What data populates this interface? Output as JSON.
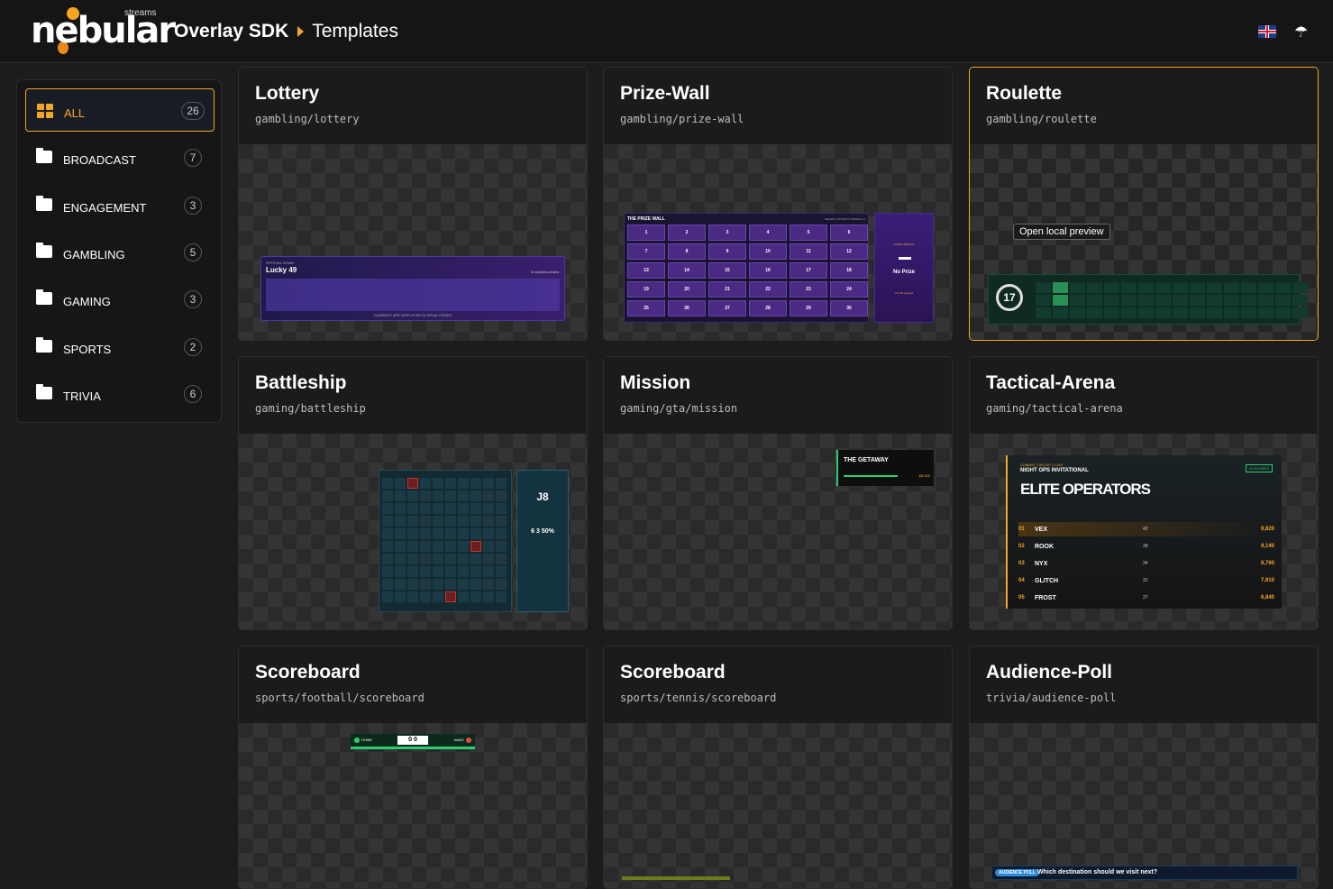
{
  "header": {
    "brand": "nebular",
    "brand_sub": "streams",
    "crumb_root": "Overlay SDK",
    "crumb_current": "Templates",
    "flag_icon": "uk-flag-icon",
    "menu_icon": "umbrella-icon",
    "accent": "#f5a623"
  },
  "sidebar": {
    "items": [
      {
        "label": "ALL",
        "count": "26",
        "icon": "grid-icon"
      },
      {
        "label": "BROADCAST",
        "count": "7",
        "icon": "folder-icon"
      },
      {
        "label": "ENGAGEMENT",
        "count": "3",
        "icon": "folder-icon"
      },
      {
        "label": "GAMBLING",
        "count": "5",
        "icon": "folder-icon"
      },
      {
        "label": "GAMING",
        "count": "3",
        "icon": "folder-icon"
      },
      {
        "label": "SPORTS",
        "count": "2",
        "icon": "folder-icon"
      },
      {
        "label": "TRIVIA",
        "count": "6",
        "icon": "folder-icon"
      }
    ]
  },
  "cards": [
    {
      "title": "Lottery",
      "path": "gambling/lottery"
    },
    {
      "title": "Prize-Wall",
      "path": "gambling/prize-wall"
    },
    {
      "title": "Roulette",
      "path": "gambling/roulette"
    },
    {
      "title": "Battleship",
      "path": "gaming/battleship"
    },
    {
      "title": "Mission",
      "path": "gaming/gta/mission"
    },
    {
      "title": "Tactical-Arena",
      "path": "gaming/tactical-arena"
    },
    {
      "title": "Scoreboard",
      "path": "sports/football/scoreboard"
    },
    {
      "title": "Scoreboard",
      "path": "sports/tennis/scoreboard"
    },
    {
      "title": "Audience-Poll",
      "path": "trivia/audience-poll"
    }
  ],
  "tooltip": "Open local preview",
  "previews": {
    "lottery": {
      "kicker": "OFFICIAL DRAW",
      "name": "Lucky 49",
      "note": "6 numbers drawn",
      "footer": "NUMBERS ARE DISPLAYED IN DRAW ORDER"
    },
    "prize_wall": {
      "title": "THE PRIZE WALL",
      "hint": "SELECT A DOOR TO REVEAL IT",
      "cells": [
        "1",
        "2",
        "3",
        "4",
        "5",
        "6",
        "7",
        "8",
        "9",
        "10",
        "11",
        "12",
        "13",
        "14",
        "15",
        "16",
        "17",
        "18",
        "19",
        "20",
        "21",
        "22",
        "23",
        "24",
        "25",
        "26",
        "27",
        "28",
        "29",
        "30"
      ],
      "side_kicker": "LATEST REVEAL",
      "side_value": "No Prize",
      "side_note": "0 of 30 opened"
    },
    "roulette": {
      "number": "17"
    },
    "battleship": {
      "coord": "J8",
      "stat": "6   3   50%"
    },
    "mission": {
      "title": "THE GETAWAY",
      "reward": "$5,000"
    },
    "tactical": {
      "kicker": "COMBAT CIRCUIT // LIVE",
      "event": "NIGHT OPS INVITATIONAL",
      "title": "ELITE OPERATORS",
      "tag": "HI-SCORES",
      "rows": [
        {
          "rank": "01",
          "name": "VEX",
          "kills": "42",
          "score": "9,820"
        },
        {
          "rank": "02",
          "name": "ROOK",
          "kills": "39",
          "score": "9,140"
        },
        {
          "rank": "03",
          "name": "NYX",
          "kills": "34",
          "score": "8,760"
        },
        {
          "rank": "04",
          "name": "GLITCH",
          "kills": "31",
          "score": "7,910"
        },
        {
          "rank": "05",
          "name": "FROST",
          "kills": "27",
          "score": "6,840"
        }
      ]
    },
    "football": {
      "home": "HOME",
      "away": "AWAY",
      "score": "0   0"
    },
    "poll": {
      "tag": "AUDIENCE POLL",
      "question": "Which destination should we visit next?"
    }
  }
}
